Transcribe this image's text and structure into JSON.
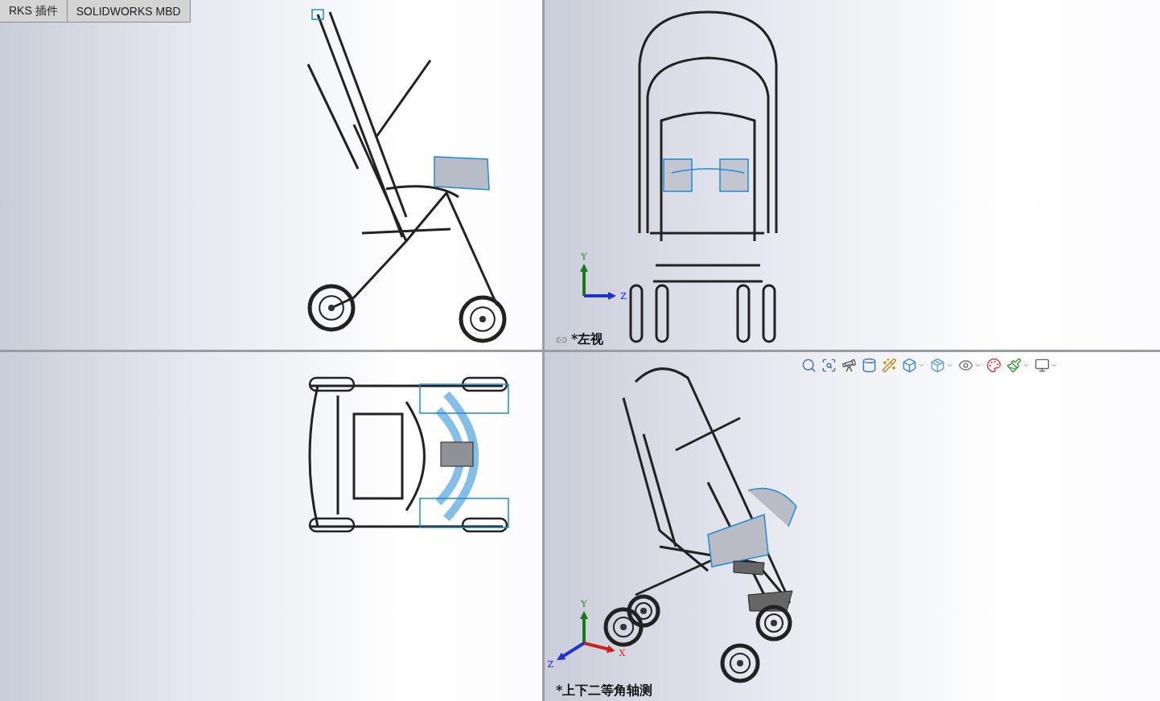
{
  "tabs": [
    {
      "label": "RKS 插件"
    },
    {
      "label": "SOLIDWORKS MBD"
    }
  ],
  "viewports": [
    {
      "kind": "side"
    },
    {
      "kind": "front",
      "label": "*左视",
      "link_icon": true,
      "triad": [
        {
          "kind": "y",
          "label": "Y"
        },
        {
          "kind": "z",
          "label": "Z"
        }
      ]
    },
    {
      "kind": "top"
    },
    {
      "kind": "iso",
      "label": "*上下二等角轴测",
      "link_icon": false,
      "triad": [
        {
          "kind": "y",
          "label": "Y"
        },
        {
          "kind": "x",
          "label": "X"
        },
        {
          "kind": "z",
          "label": "Z"
        }
      ],
      "toolbar": [
        {
          "kind": "zoom-fit",
          "dropdown": false
        },
        {
          "kind": "zoom-area",
          "dropdown": false
        },
        {
          "kind": "previous-view",
          "dropdown": false
        },
        {
          "kind": "section",
          "dropdown": false
        },
        {
          "kind": "dynamic-annotation",
          "dropdown": false
        },
        {
          "kind": "view-orientation",
          "dropdown": true
        },
        {
          "kind": "display-style",
          "dropdown": true
        },
        {
          "kind": "hide-show",
          "dropdown": true
        },
        {
          "kind": "edit-appearance",
          "dropdown": false
        },
        {
          "kind": "scene",
          "dropdown": true
        },
        {
          "kind": "view-settings",
          "dropdown": true
        }
      ]
    }
  ]
}
